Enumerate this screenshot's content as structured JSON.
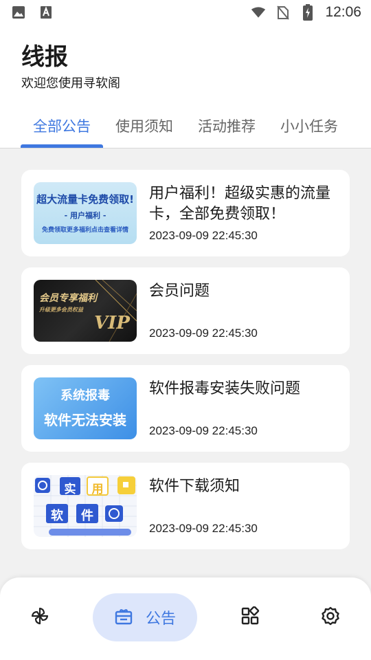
{
  "status_bar": {
    "time": "12:06",
    "left_icons": [
      "image-icon",
      "font-a-icon"
    ],
    "right_icons": [
      "wifi-icon",
      "no-sim-icon",
      "battery-charging-icon"
    ]
  },
  "header": {
    "title": "线报",
    "subtitle": "欢迎您使用寻软阁"
  },
  "tabs": [
    {
      "label": "全部公告",
      "active": true
    },
    {
      "label": "使用须知",
      "active": false
    },
    {
      "label": "活动推荐",
      "active": false
    },
    {
      "label": "小小任务",
      "active": false
    }
  ],
  "notices": [
    {
      "title": "用户福利！超级实惠的流量卡，全部免费领取！",
      "date": "2023-09-09 22:45:30",
      "thumb": {
        "line1": "超大流量卡免费领取!",
        "line2": "- 用户福利 -",
        "line3": "免费领取更多福利点击查看详情"
      }
    },
    {
      "title": "会员问题",
      "date": "2023-09-09 22:45:30",
      "thumb": {
        "line1": "会员专享福利",
        "line2": "升级更多会员权益",
        "line3": "VIP"
      }
    },
    {
      "title": "软件报毒安装失败问题",
      "date": "2023-09-09 22:45:30",
      "thumb": {
        "line1": "系统报毒",
        "line2": "软件无法安装"
      }
    },
    {
      "title": "软件下载须知",
      "date": "2023-09-09 22:45:30",
      "thumb": {
        "line1": "实",
        "line2": "用",
        "line3": "软",
        "line4": "件"
      }
    }
  ],
  "bottom_nav": [
    {
      "icon": "pinwheel-icon",
      "label": "",
      "active": false
    },
    {
      "icon": "notice-box-icon",
      "label": "公告",
      "active": true
    },
    {
      "icon": "apps-grid-icon",
      "label": "",
      "active": false
    },
    {
      "icon": "gear-icon",
      "label": "",
      "active": false
    }
  ],
  "colors": {
    "accent": "#3f78e0",
    "accent_pill": "#dde6fb",
    "background": "#f1f1f1"
  }
}
